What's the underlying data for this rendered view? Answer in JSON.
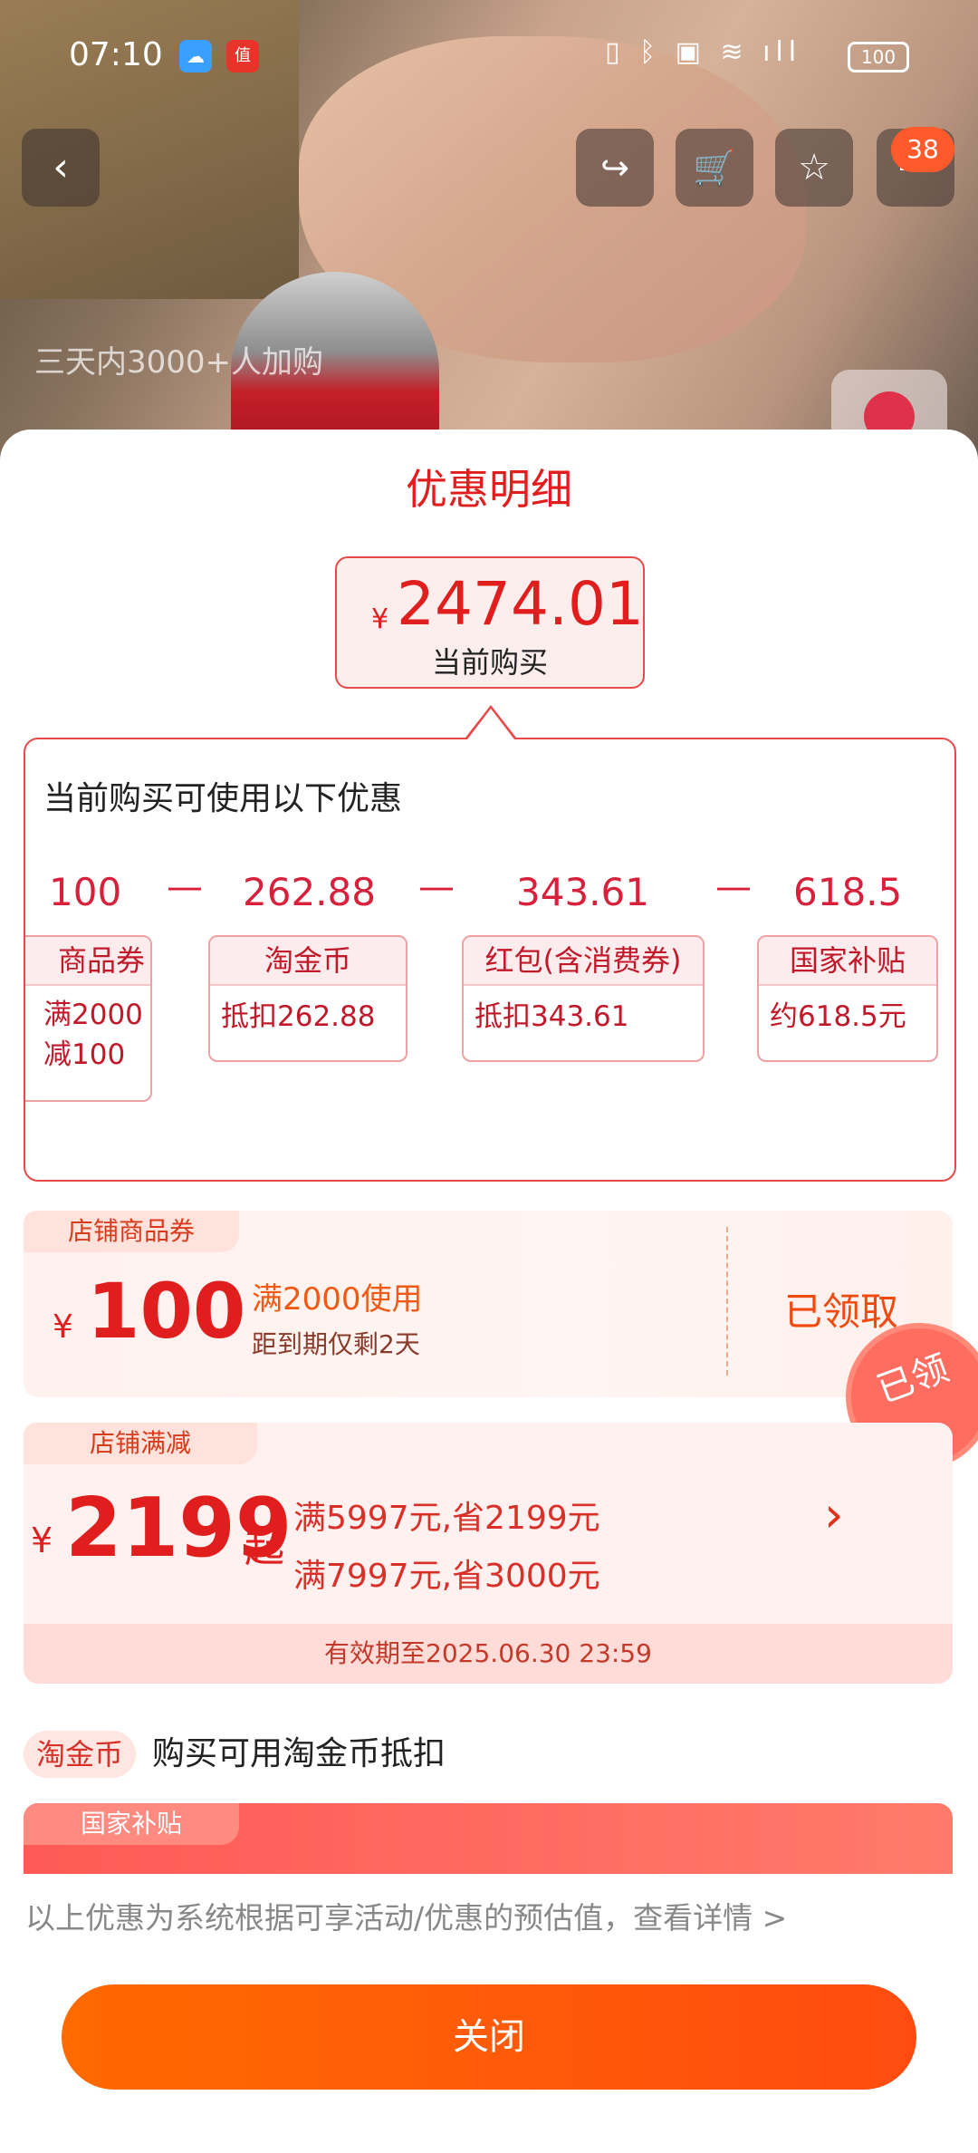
{
  "status_bar": {
    "time": "07:10",
    "battery": "100"
  },
  "header": {
    "badge_count": "38",
    "social_proof": "三天内3000+人加购"
  },
  "sheet": {
    "title": "优惠明细",
    "current_price": {
      "symbol": "¥",
      "value": "2474.01",
      "label": "当前购买"
    },
    "panel": {
      "heading": "当前购买可使用以下优惠",
      "amounts": [
        "100",
        "262.88",
        "343.61",
        "618.5"
      ],
      "operator": "—",
      "cards": [
        {
          "title": "商品券",
          "lines": [
            "满2000",
            "减100"
          ]
        },
        {
          "title": "淘金币",
          "lines": [
            "抵扣262.88"
          ]
        },
        {
          "title": "红包(含消费券)",
          "lines": [
            "抵扣343.61"
          ]
        },
        {
          "title": "国家补贴",
          "lines": [
            "约618.5元"
          ]
        }
      ]
    },
    "store_coupon": {
      "tag": "店铺商品券",
      "symbol": "¥",
      "amount": "100",
      "condition": "满2000使用",
      "expiry": "距到期仅剩2天",
      "action": "已领取",
      "stamp": "已领"
    },
    "store_discount": {
      "tag": "店铺满减",
      "symbol": "¥",
      "amount": "2199",
      "suffix": "起",
      "rules": [
        "满5997元,省2199元",
        "满7997元,省3000元"
      ],
      "validity": "有效期至2025.06.30 23:59"
    },
    "taojinbi": {
      "tag": "淘金币",
      "text": "购买可用淘金币抵扣"
    },
    "subsidy": {
      "tag": "国家补贴"
    },
    "footnote": "以上优惠为系统根据可享活动/优惠的预估值，查看详情 >",
    "close_label": "关闭"
  }
}
